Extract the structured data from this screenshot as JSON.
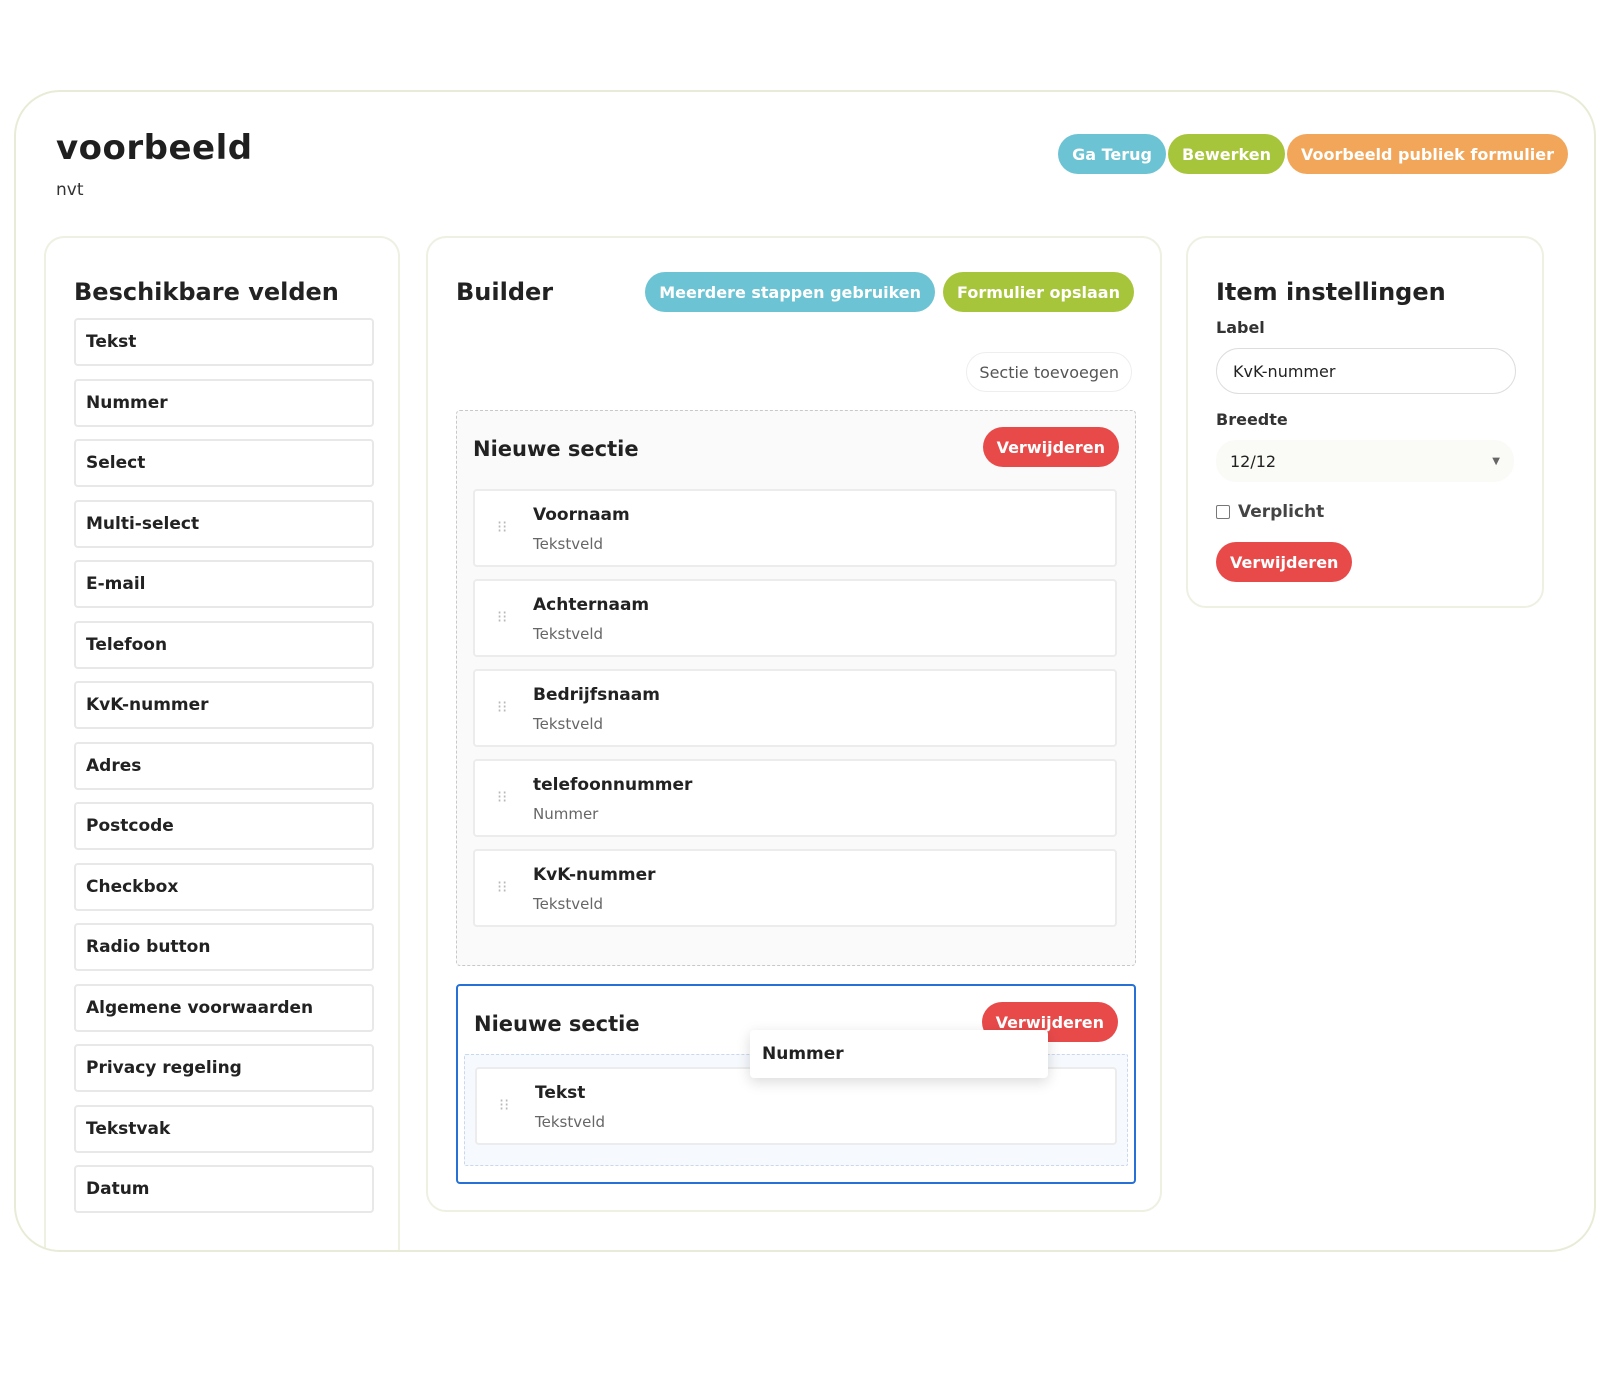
{
  "header": {
    "title": "voorbeeld",
    "subtitle": "nvt",
    "actions": {
      "back_label": "Ga Terug",
      "edit_label": "Bewerken",
      "preview_label": "Voorbeeld publiek formulier"
    }
  },
  "fields_panel": {
    "title": "Beschikbare velden",
    "items": [
      {
        "label": "Tekst"
      },
      {
        "label": "Nummer"
      },
      {
        "label": "Select"
      },
      {
        "label": "Multi-select"
      },
      {
        "label": "E-mail"
      },
      {
        "label": "Telefoon"
      },
      {
        "label": "KvK-nummer"
      },
      {
        "label": "Adres"
      },
      {
        "label": "Postcode"
      },
      {
        "label": "Checkbox"
      },
      {
        "label": "Radio button"
      },
      {
        "label": "Algemene voorwaarden"
      },
      {
        "label": "Privacy regeling"
      },
      {
        "label": "Tekstvak"
      },
      {
        "label": "Datum"
      }
    ]
  },
  "builder": {
    "title": "Builder",
    "multi_step_label": "Meerdere stappen gebruiken",
    "save_label": "Formulier opslaan",
    "add_section_label": "Sectie toevoegen",
    "sections": [
      {
        "title": "Nieuwe sectie",
        "delete_label": "Verwijderen",
        "fields": [
          {
            "label": "Voornaam",
            "type": "Tekstveld"
          },
          {
            "label": "Achternaam",
            "type": "Tekstveld"
          },
          {
            "label": "Bedrijfsnaam",
            "type": "Tekstveld"
          },
          {
            "label": "telefoonnummer",
            "type": "Nummer"
          },
          {
            "label": "KvK-nummer",
            "type": "Tekstveld"
          }
        ]
      },
      {
        "title": "Nieuwe sectie",
        "delete_label": "Verwijderen",
        "fields": [
          {
            "label": "Tekst",
            "type": "Tekstveld"
          }
        ],
        "drag_ghost_label": "Nummer"
      }
    ]
  },
  "settings": {
    "title": "Item instellingen",
    "label_caption": "Label",
    "label_value": "KvK-nummer",
    "width_caption": "Breedte",
    "width_value": "12/12",
    "required_label": "Verplicht",
    "delete_label": "Verwijderen"
  },
  "colors": {
    "teal": "#6cc3d3",
    "green": "#a7c53a",
    "orange": "#f2a65a",
    "red": "#e84a4a",
    "active_border": "#2670d8"
  },
  "icons": {
    "drag_handle": "drag-handle-icon",
    "dropdown": "chevron-down-icon"
  }
}
